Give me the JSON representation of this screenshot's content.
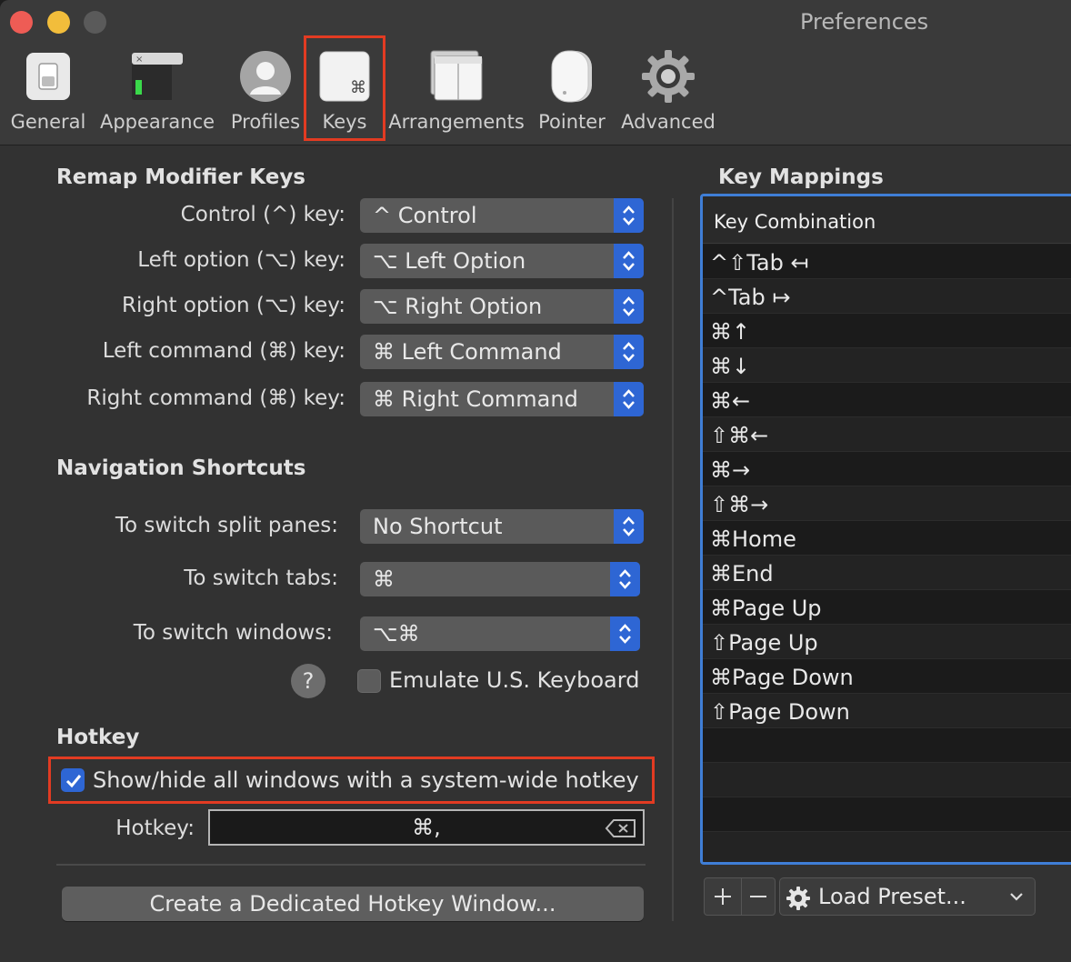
{
  "window": {
    "title": "Preferences"
  },
  "toolbar": {
    "items": [
      {
        "label": "General",
        "icon": "switch-icon"
      },
      {
        "label": "Appearance",
        "icon": "terminal-window-icon"
      },
      {
        "label": "Profiles",
        "icon": "person-icon"
      },
      {
        "label": "Keys",
        "icon": "command-key-icon"
      },
      {
        "label": "Arrangements",
        "icon": "window-stack-icon"
      },
      {
        "label": "Pointer",
        "icon": "mouse-icon"
      },
      {
        "label": "Advanced",
        "icon": "gear-icon"
      }
    ],
    "selected": "Keys"
  },
  "remap": {
    "title": "Remap Modifier Keys",
    "rows": [
      {
        "label": "Control (^) key:",
        "value": "^ Control"
      },
      {
        "label": "Left option (⌥) key:",
        "value": "⌥ Left Option"
      },
      {
        "label": "Right option (⌥) key:",
        "value": "⌥ Right Option"
      },
      {
        "label": "Left command (⌘) key:",
        "value": "⌘ Left Command"
      },
      {
        "label": "Right command (⌘) key:",
        "value": "⌘ Right Command"
      }
    ]
  },
  "navigation": {
    "title": "Navigation Shortcuts",
    "rows": [
      {
        "label": "To switch split panes:",
        "value": "No Shortcut"
      },
      {
        "label": "To switch tabs:",
        "value": "⌘"
      },
      {
        "label": "To switch windows:",
        "value": "⌥⌘"
      }
    ],
    "help": "?",
    "emulate_label": "Emulate U.S. Keyboard",
    "emulate_checked": false
  },
  "hotkey": {
    "title": "Hotkey",
    "show_hide_label": "Show/hide all windows with a system-wide hotkey",
    "show_hide_checked": true,
    "field_label": "Hotkey:",
    "field_value": "⌘,",
    "create_button": "Create a Dedicated Hotkey Window..."
  },
  "key_mappings": {
    "title": "Key Mappings",
    "column_header": "Key Combination",
    "rows": [
      "^⇧Tab ↤",
      "^Tab ↦",
      "⌘↑",
      "⌘↓",
      "⌘←",
      "⇧⌘←",
      "⌘→",
      "⇧⌘→",
      "⌘Home",
      "⌘End",
      "⌘Page Up",
      "⇧Page Up",
      "⌘Page Down",
      "⇧Page Down",
      "",
      "",
      "",
      ""
    ],
    "load_preset": "Load Preset..."
  },
  "colors": {
    "accent": "#2e66d4",
    "highlight": "#e23b22",
    "table_border": "#3f7ed6"
  }
}
